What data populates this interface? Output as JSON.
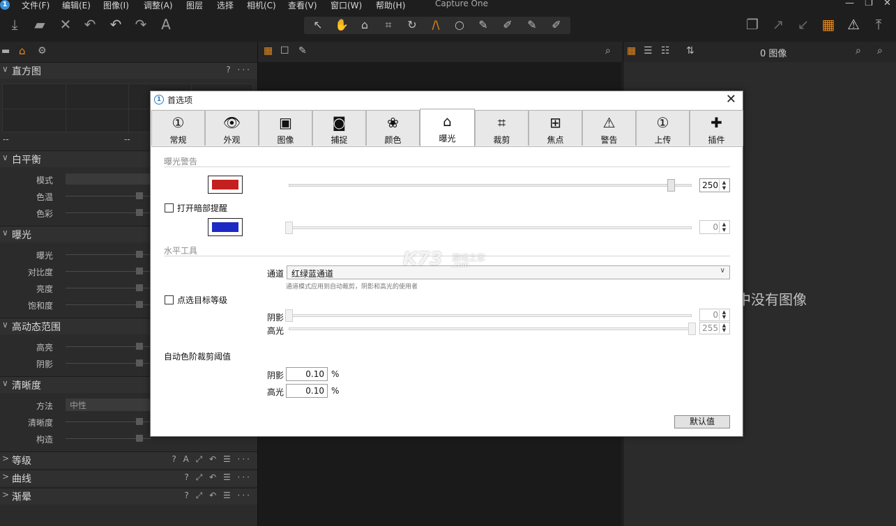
{
  "menubar": {
    "items": [
      "文件(F)",
      "编辑(E)",
      "图像(I)",
      "调整(A)",
      "图层",
      "选择",
      "相机(C)",
      "查看(V)",
      "窗口(W)",
      "帮助(H)"
    ],
    "window_title": "Capture One",
    "controls": [
      "—",
      "❐",
      "✕"
    ]
  },
  "toolbar": {
    "left_icons": [
      "import-icon",
      "export-icon",
      "delete-icon",
      "undo-history-icon",
      "undo-icon",
      "redo-icon",
      "auto-adjust-icon"
    ],
    "cursor_tools": [
      "select-cursor-icon",
      "pan-hand-icon",
      "loupe-icon",
      "crop-icon",
      "rotate-icon",
      "keystone-icon",
      "spot-removal-icon",
      "brush-icon",
      "eraser-icon",
      "gradient-icon",
      "annotation-icon"
    ],
    "right_icons": [
      "stacked-windows-icon",
      "copy-adjustments-icon",
      "apply-adjustments-icon",
      "grid-overlay-icon",
      "warning-icon",
      "upload-icon"
    ],
    "accent": "#e8891c"
  },
  "left_panel": {
    "histogram": {
      "title": "直方图",
      "readout_left": "--",
      "readout_mid": "--"
    },
    "white_balance": {
      "title": "白平衡",
      "rows": [
        "模式",
        "色温",
        "色彩"
      ]
    },
    "exposure": {
      "title": "曝光",
      "rows": [
        "曝光",
        "对比度",
        "亮度",
        "饱和度"
      ]
    },
    "hdr": {
      "title": "高动态范围",
      "rows": [
        "高亮",
        "阴影"
      ]
    },
    "clarity": {
      "title": "清晰度",
      "rows": [
        "方法",
        "清晰度",
        "构造"
      ],
      "method_value": "中性"
    },
    "collapsed": [
      "等级",
      "曲线",
      "渐晕"
    ],
    "help": "?",
    "more": "···"
  },
  "browser": {
    "count": "0 图像",
    "empty_message": "中没有图像"
  },
  "dialog": {
    "title": "首选项",
    "close": "✕",
    "tabs": [
      {
        "label": "常规",
        "icon": "①"
      },
      {
        "label": "外观",
        "icon": "👁"
      },
      {
        "label": "图像",
        "icon": "▣"
      },
      {
        "label": "捕捉",
        "icon": "◙"
      },
      {
        "label": "颜色",
        "icon": "❀"
      },
      {
        "label": "曝光",
        "icon": "⌂"
      },
      {
        "label": "裁剪",
        "icon": "⌗"
      },
      {
        "label": "焦点",
        "icon": "⊞"
      },
      {
        "label": "警告",
        "icon": "⚠"
      },
      {
        "label": "上传",
        "icon": "①"
      },
      {
        "label": "插件",
        "icon": "✚"
      }
    ],
    "active_tab": 5,
    "exposure_warning": {
      "group_title": "曝光警告",
      "highlight_color": "#c42020",
      "highlight_value": "250",
      "shadow_checkbox": "打开暗部提醒",
      "shadow_color": "#1c2ac4",
      "shadow_value": "0"
    },
    "levels_tool": {
      "group_title": "水平工具",
      "channel_label": "通道",
      "channel_value": "红绿蓝通道",
      "hint": "通道模式应用到自动裁剪，阴影和高光的使用者",
      "pick_checkbox": "点选目标等级",
      "shadow_label": "阴影",
      "shadow_value": "0",
      "highlight_label": "高光",
      "highlight_value": "255"
    },
    "auto_levels": {
      "group_title": "自动色阶裁剪阈值",
      "shadow_label": "阴影",
      "shadow_value": "0.10",
      "highlight_label": "高光",
      "highlight_value": "0.10",
      "unit": "%"
    },
    "default_button": "默认值"
  },
  "watermark": {
    "main": "K73",
    "sub": "游戏之家",
    "domain": ".com"
  }
}
